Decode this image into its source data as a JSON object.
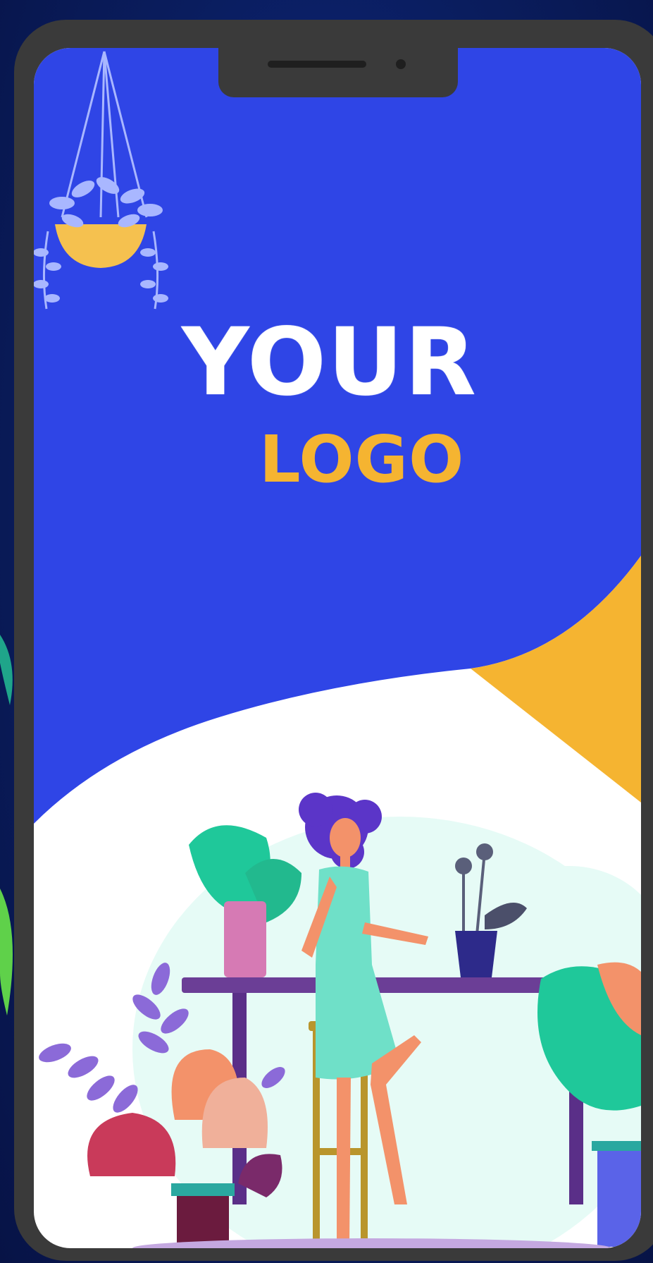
{
  "splash": {
    "logo_primary": "YOUR",
    "logo_secondary": "LOGO"
  },
  "colors": {
    "background": "#0a1d5e",
    "phone_frame": "#3a3a3a",
    "screen_blue": "#2f45e6",
    "accent_yellow": "#f5b431",
    "logo_white": "#ffffff"
  },
  "illustration": {
    "icons": [
      "hanging-plant-icon",
      "woman-at-table-icon",
      "monstera-plant-icon",
      "fern-bush-icon",
      "flower-vase-icon",
      "bar-stool-icon"
    ]
  }
}
